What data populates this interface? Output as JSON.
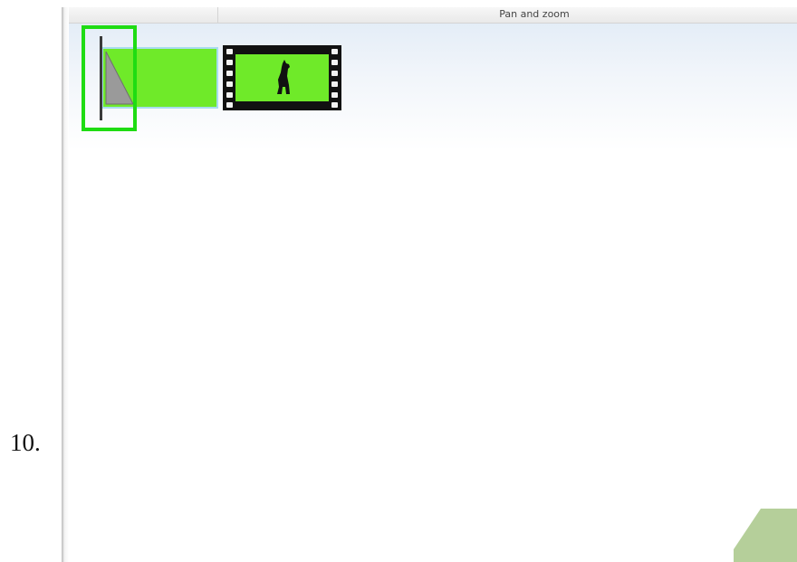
{
  "step": {
    "number": "10."
  },
  "panel": {
    "header_label": "Pan and zoom"
  },
  "timeline": {
    "clips": [
      {
        "kind": "color-clip",
        "fill": "#6fea29"
      },
      {
        "kind": "video-clip",
        "fill": "#6fea29",
        "icon": "dog-silhouette-icon"
      }
    ],
    "highlight_color": "#1fdc13",
    "selection_border_color": "#a8dcee"
  },
  "decor": {
    "corner_color": "#b5cf9a"
  }
}
